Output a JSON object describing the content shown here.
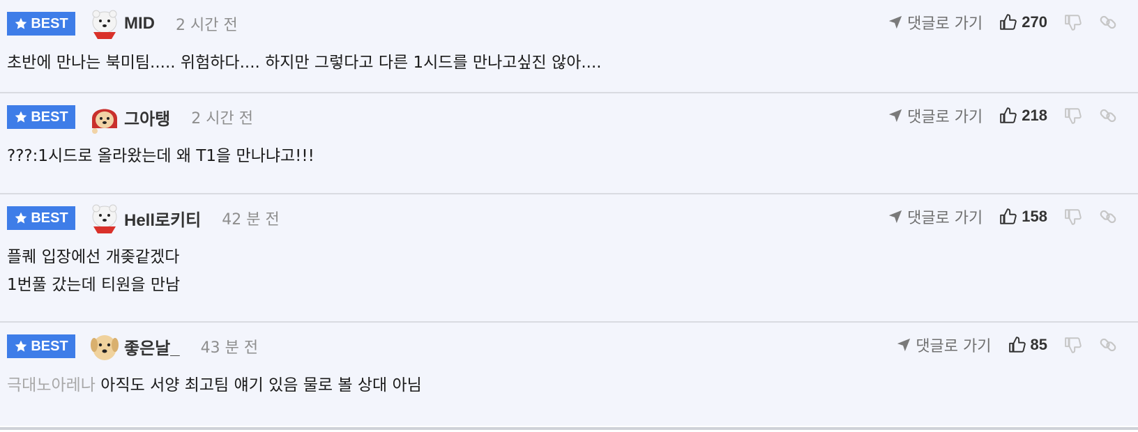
{
  "comments": [
    {
      "badge": "BEST",
      "avatar": "polar-bear-avatar",
      "nickname": "MID",
      "time": "2 시간 전",
      "reply_label": "댓글로 가기",
      "likes": "270",
      "text_lines": [
        "초반에 만나는 북미팀..... 위험하다.... 하지만 그렇다고 다른 1시드를 만나고싶진 않아...."
      ]
    },
    {
      "badge": "BEST",
      "avatar": "puppy-red-hood-avatar",
      "nickname": "그아탱",
      "time": "2 시간 전",
      "reply_label": "댓글로 가기",
      "likes": "218",
      "text_lines": [
        "???:1시드로 올라왔는데 왜 T1을 만나냐고!!!"
      ]
    },
    {
      "badge": "BEST",
      "avatar": "polar-bear-avatar",
      "nickname": "Hell로키티",
      "time": "42 분 전",
      "reply_label": "댓글로 가기",
      "likes": "158",
      "text_lines": [
        "플퀘 입장에선 개좆같겠다",
        "1번풀 갔는데 티원을 만남"
      ]
    },
    {
      "badge": "BEST",
      "avatar": "puppy-avatar",
      "nickname": "좋은날_",
      "time": "43 분 전",
      "reply_label": "댓글로 가기",
      "likes": "85",
      "mention": "극대노아레나",
      "text_lines": [
        "아직도 서양 최고팀 얘기 있음 물로 볼 상대 아님"
      ]
    }
  ],
  "colors": {
    "badge": "#3e7de8",
    "background": "#f3f5fc",
    "muted": "#8e8e8e",
    "mention": "#a8a8a8"
  }
}
